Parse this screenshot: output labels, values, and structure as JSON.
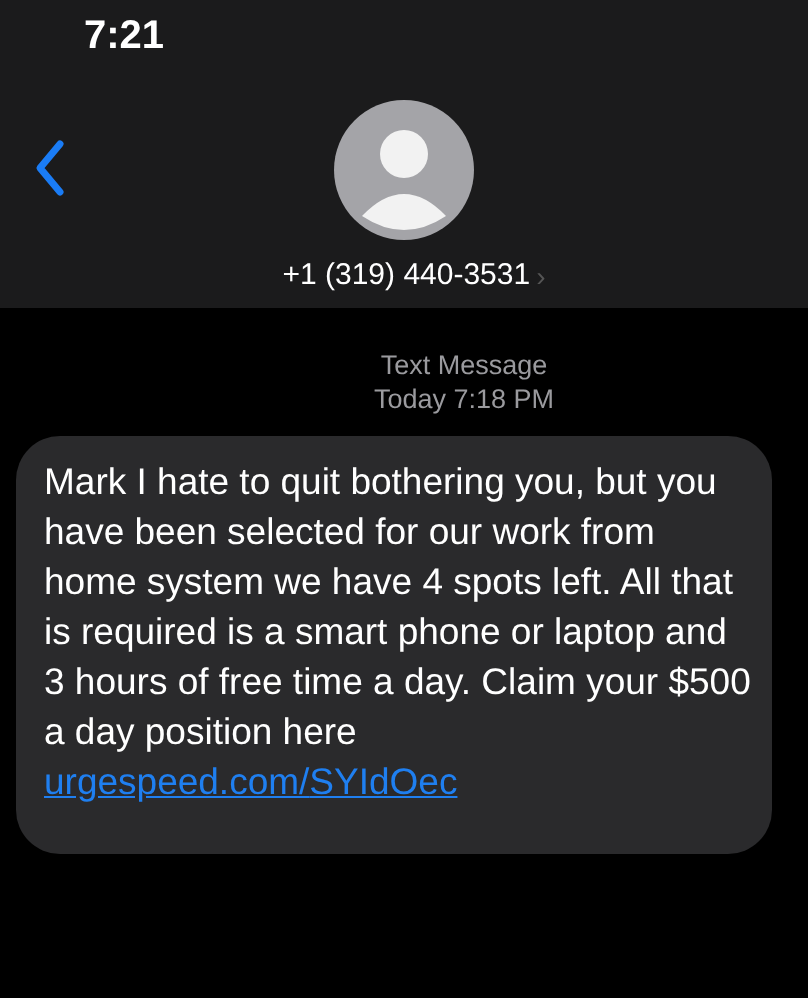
{
  "status_bar": {
    "time": "7:21"
  },
  "header": {
    "contact": "+1 (319) 440-3531",
    "chevron": "›"
  },
  "thread": {
    "label": "Text Message",
    "timestamp": "Today 7:18 PM"
  },
  "message": {
    "text": "Mark I hate to quit bothering you, but you have been selected for our work from home system we have 4 spots left. All that is required is a smart phone or laptop and 3 hours of free time a day. Claim your $500 a day position here",
    "link_parts": [
      "urgespeed.com/",
      "SYIdOec"
    ]
  }
}
